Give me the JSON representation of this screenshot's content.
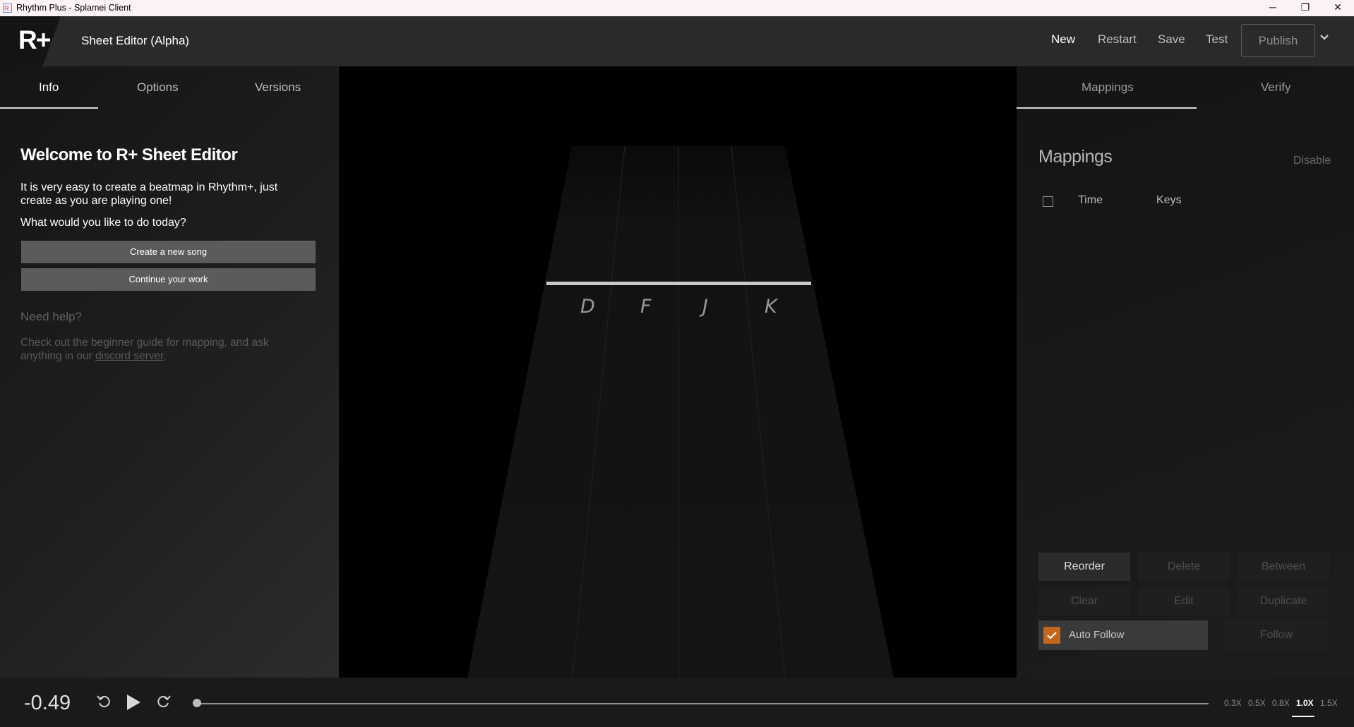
{
  "window": {
    "title": "Rhythm Plus - Splamei Client",
    "controls": [
      "─",
      "❐",
      "✕"
    ]
  },
  "header": {
    "logo": "R+",
    "title": "Sheet Editor (Alpha)",
    "actions": {
      "new": "New",
      "restart": "Restart",
      "save": "Save",
      "test": "Test",
      "publish": "Publish"
    }
  },
  "left": {
    "tabs": [
      "Info",
      "Options",
      "Versions"
    ],
    "welcome_title": "Welcome to R+ Sheet Editor",
    "description": "It is very easy to create a beatmap in Rhythm+, just create as you are playing one!",
    "question": "What would you like to do today?",
    "create_button": "Create a new song",
    "continue_button": "Continue your work",
    "help_title": "Need help?",
    "help_text": "Check out the beginner guide for mapping, and ask anything in our ",
    "help_link": "discord server",
    "help_end": "."
  },
  "highway": {
    "keys": [
      "D",
      "F",
      "J",
      "K"
    ]
  },
  "right": {
    "tabs": [
      "Mappings",
      "Verify"
    ],
    "title": "Mappings",
    "disable": "Disable",
    "columns": {
      "time": "Time",
      "keys": "Keys"
    },
    "buttons": {
      "reorder": "Reorder",
      "delete": "Delete",
      "between": "Between",
      "clear": "Clear",
      "edit": "Edit",
      "duplicate": "Duplicate",
      "follow": "Follow"
    },
    "auto_follow": {
      "label": "Auto Follow",
      "checked": true
    }
  },
  "transport": {
    "time": "-0.49",
    "progress": 0,
    "speeds": [
      "0.3X",
      "0.5X",
      "0.8X",
      "1.0X",
      "1.5X"
    ],
    "active_speed": "1.0X"
  },
  "colors": {
    "accent": "#c2671c"
  }
}
